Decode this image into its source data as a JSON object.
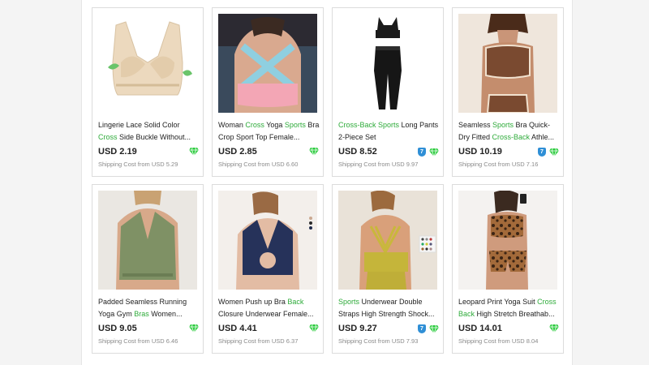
{
  "products": [
    {
      "title_parts": [
        [
          "Lingerie Lace Solid Color ",
          false
        ],
        [
          "Cross",
          true
        ],
        [
          " Side Buckle Without...",
          false
        ]
      ],
      "price": "USD 2.19",
      "shipping": "Shipping Cost from USD 5.29",
      "badges": [
        "diamond"
      ],
      "image": "beige-lace-bra"
    },
    {
      "title_parts": [
        [
          "Woman ",
          false
        ],
        [
          "Cross",
          true
        ],
        [
          " Yoga ",
          false
        ],
        [
          "Sports",
          true
        ],
        [
          " Bra Crop Sport Top Female...",
          false
        ]
      ],
      "price": "USD 2.85",
      "shipping": "Shipping Cost from USD 6.60",
      "badges": [
        "diamond"
      ],
      "image": "pink-cross-back-bra"
    },
    {
      "title_parts": [
        [
          "Cross-Back",
          true
        ],
        [
          " ",
          false
        ],
        [
          "Sports",
          true
        ],
        [
          " Long Pants 2-Piece Set",
          false
        ]
      ],
      "price": "USD 8.52",
      "shipping": "Shipping Cost from USD 9.97",
      "badges": [
        "7",
        "diamond"
      ],
      "image": "black-2-piece-set"
    },
    {
      "title_parts": [
        [
          "Seamless ",
          false
        ],
        [
          "Sports",
          true
        ],
        [
          " Bra Quick-Dry Fitted ",
          false
        ],
        [
          "Cross-Back",
          true
        ],
        [
          " Athle...",
          false
        ]
      ],
      "price": "USD 10.19",
      "shipping": "Shipping Cost from USD 7.16",
      "badges": [
        "7",
        "diamond"
      ],
      "image": "brown-sports-set"
    },
    {
      "title_parts": [
        [
          "Padded Seamless Running Yoga Gym ",
          false
        ],
        [
          "Bras",
          true
        ],
        [
          " Women...",
          false
        ]
      ],
      "price": "USD 9.05",
      "shipping": "Shipping Cost from USD 6.46",
      "badges": [
        "diamond"
      ],
      "image": "green-racerback-bra"
    },
    {
      "title_parts": [
        [
          "Women Push up Bra ",
          false
        ],
        [
          "Back",
          true
        ],
        [
          " Closure Underwear Female...",
          false
        ]
      ],
      "price": "USD 4.41",
      "shipping": "Shipping Cost from USD 6.37",
      "badges": [
        "diamond"
      ],
      "image": "navy-back-closure-bra"
    },
    {
      "title_parts": [
        [
          "Sports",
          true
        ],
        [
          " Underwear Double Straps High Strength Shock...",
          false
        ]
      ],
      "price": "USD 9.27",
      "shipping": "Shipping Cost from USD 7.93",
      "badges": [
        "7",
        "diamond"
      ],
      "image": "yellow-double-strap-bra"
    },
    {
      "title_parts": [
        [
          "Leopard Print Yoga Suit ",
          false
        ],
        [
          "Cross",
          true
        ],
        [
          " ",
          false
        ],
        [
          "Back",
          true
        ],
        [
          " High Stretch Breathab...",
          false
        ]
      ],
      "price": "USD 14.01",
      "shipping": "Shipping Cost from USD 8.04",
      "badges": [
        "diamond"
      ],
      "image": "leopard-yoga-suit"
    }
  ],
  "colors": {
    "highlight": "#2eab3a",
    "badge_blue": "#2f8fd6",
    "diamond_green": "#2ecc40"
  }
}
